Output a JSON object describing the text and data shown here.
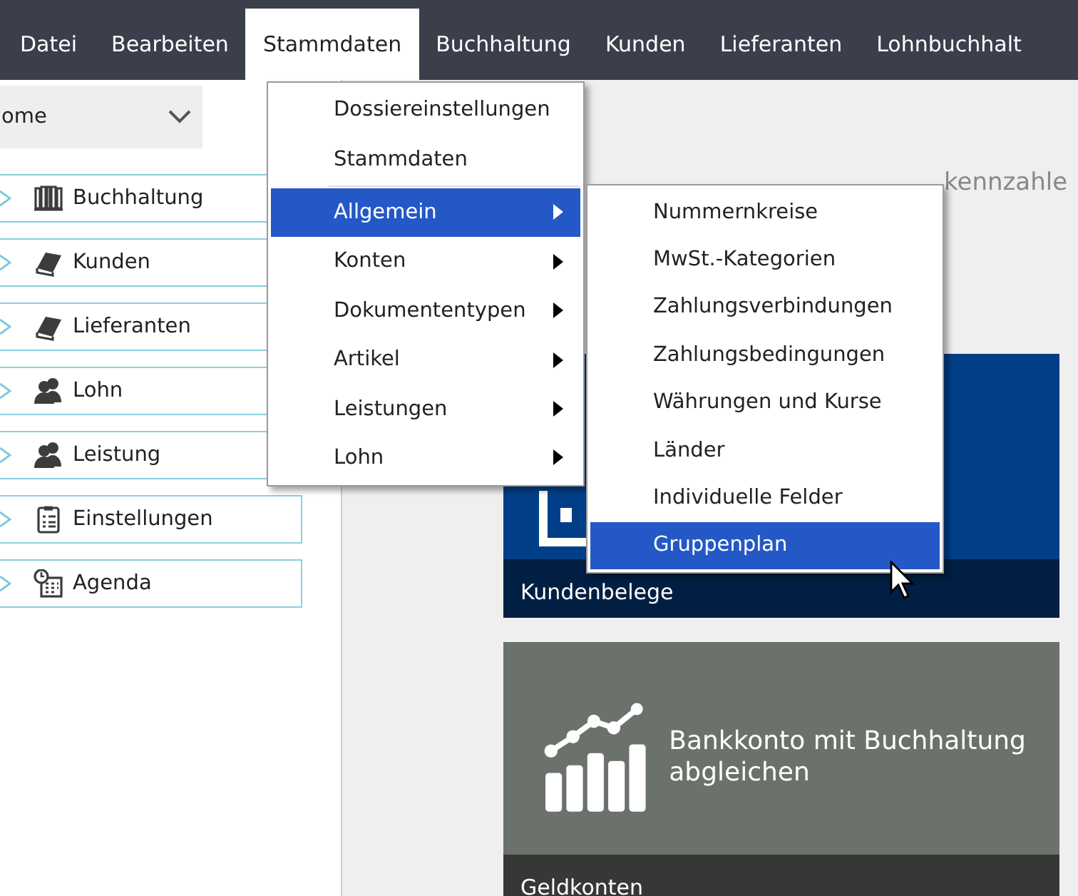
{
  "menubar": [
    {
      "label": "Datei",
      "selected": false
    },
    {
      "label": "Bearbeiten",
      "selected": false
    },
    {
      "label": "Stammdaten",
      "selected": true
    },
    {
      "label": "Buchhaltung",
      "selected": false
    },
    {
      "label": "Kunden",
      "selected": false
    },
    {
      "label": "Lieferanten",
      "selected": false
    },
    {
      "label": "Lohnbuchhalt",
      "selected": false
    }
  ],
  "home_dropdown": {
    "value": "ome"
  },
  "sidebar": {
    "items": [
      {
        "label": "Buchhaltung",
        "kind": "book",
        "expanded": false
      },
      {
        "label": "Kunden",
        "kind": "notebook",
        "expanded": false
      },
      {
        "label": "Lieferanten",
        "kind": "notebook",
        "expanded": false
      },
      {
        "label": "Lohn",
        "kind": "people",
        "expanded": false
      },
      {
        "label": "Leistung",
        "kind": "people",
        "expanded": false
      },
      {
        "label": "Einstellungen",
        "kind": "clipboard",
        "expanded": false
      },
      {
        "label": "Agenda",
        "kind": "calendar",
        "expanded": false
      }
    ]
  },
  "dashboard": {
    "heading": "kennzahle",
    "tiles": [
      {
        "kind": "documents",
        "color": "#003f87",
        "caption": "Kundenbelege"
      },
      {
        "kind": "chart",
        "color": "#6b716b",
        "text": "Bankkonto mit Buchhaltung abgleichen",
        "caption": "Geldkonten"
      }
    ]
  },
  "menu": {
    "items": [
      {
        "kind": "command",
        "label": "Dossiereinstellungen",
        "selected": false
      },
      {
        "kind": "command",
        "label": "Stammdaten",
        "selected": false
      },
      {
        "kind": "separator"
      },
      {
        "kind": "submenu",
        "label": "Allgemein",
        "selected": true
      },
      {
        "kind": "submenu",
        "label": "Konten",
        "selected": false
      },
      {
        "kind": "submenu",
        "label": "Dokumententypen",
        "selected": false
      },
      {
        "kind": "submenu",
        "label": "Artikel",
        "selected": false
      },
      {
        "kind": "submenu",
        "label": "Leistungen",
        "selected": false
      },
      {
        "kind": "submenu",
        "label": "Lohn",
        "selected": false
      }
    ]
  },
  "submenu": {
    "items": [
      {
        "label": "Nummernkreise",
        "selected": false
      },
      {
        "label": "MwSt.-Kategorien",
        "selected": false
      },
      {
        "label": "Zahlungsverbindungen",
        "selected": false
      },
      {
        "label": "Zahlungsbedingungen",
        "selected": false
      },
      {
        "label": "Währungen und Kurse",
        "selected": false
      },
      {
        "label": "Länder",
        "selected": false
      },
      {
        "label": "Individuelle Felder",
        "selected": false
      },
      {
        "label": "Gruppenplan",
        "selected": true
      }
    ]
  }
}
